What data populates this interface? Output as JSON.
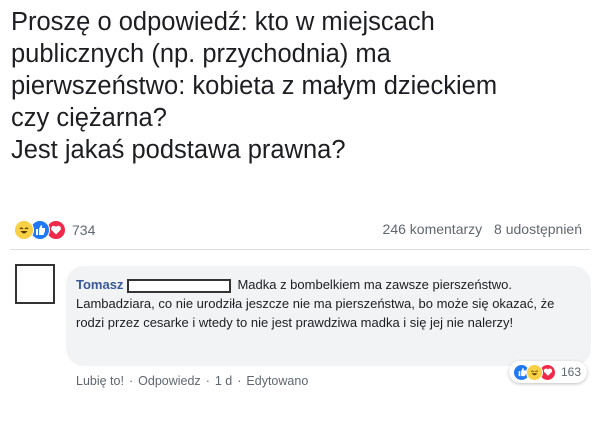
{
  "post": {
    "text": "Proszę o odpowiedź: kto w miejscach\npublicznych (np. przychodnia) ma\npierwszeństwo: kobieta z małym dzieckiem\nczy ciężarna?\nJest jakaś podstawa prawna?"
  },
  "stats": {
    "reactions_count": "734",
    "comments": "246 komentarzy",
    "shares": "8 udostępnień"
  },
  "comment": {
    "author": "Tomasz",
    "text": "Madka z bombelkiem ma zawsze pierszeństwo. Lambadziara, co nie urodziła jeszcze nie ma pierszeństwa, bo może się okazać, że rodzi przez cesarke i wtedy to nie jest prawdziwa madka i się jej nie nalerzy!",
    "actions": {
      "like": "Lubię to!",
      "reply": "Odpowiedz",
      "time": "1 d",
      "edited": "Edytowano"
    },
    "reactions_count": "163"
  },
  "colors": {
    "like": "#2078f4",
    "love": "#f0284a",
    "haha": "#f7d046",
    "author": "#385898"
  },
  "icons": [
    "haha-reaction-icon",
    "like-reaction-icon",
    "love-reaction-icon"
  ]
}
